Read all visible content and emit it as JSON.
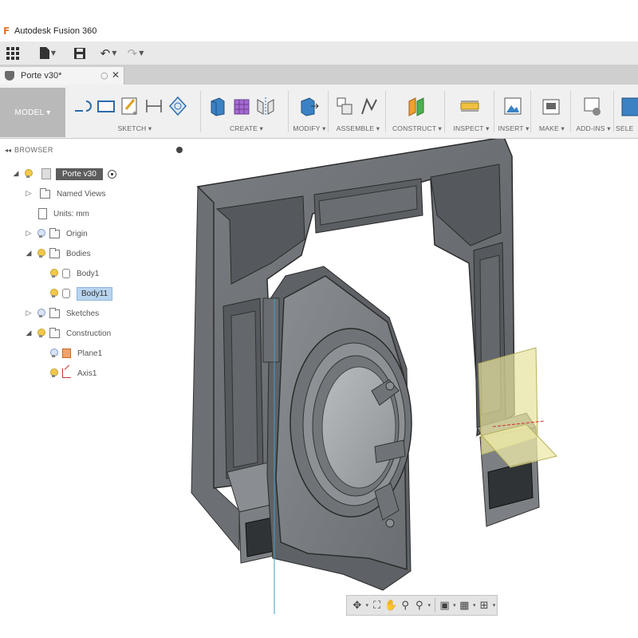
{
  "app": {
    "logo": "F",
    "title": "Autodesk Fusion 360"
  },
  "qat": {
    "grid_icon": "grid-icon",
    "file_icon": "file-icon",
    "save_icon": "save-icon",
    "undo_icon": "undo-icon",
    "redo_icon": "redo-icon"
  },
  "doc_tab": {
    "label": "Porte v30*",
    "status": "○",
    "close": "✕"
  },
  "ribbon": {
    "workspace": "MODEL ▾",
    "groups": [
      "SKETCH ▾",
      "CREATE ▾",
      "MODIFY ▾",
      "ASSEMBLE ▾",
      "CONSTRUCT ▾",
      "INSPECT ▾",
      "INSERT ▾",
      "MAKE ▾",
      "ADD-INS ▾",
      "SELE"
    ]
  },
  "browser": {
    "collapse": "◂◂",
    "title": "BROWSER",
    "root": "Porte v30",
    "items": [
      {
        "label": "Named Views"
      },
      {
        "label": "Units: mm"
      },
      {
        "label": "Origin"
      },
      {
        "label": "Bodies"
      },
      {
        "label": "Body1"
      },
      {
        "label": "Body11"
      },
      {
        "label": "Sketches"
      },
      {
        "label": "Construction"
      },
      {
        "label": "Plane1"
      },
      {
        "label": "Axis1"
      }
    ]
  },
  "navbar": [
    "orbit-icon",
    "look-at-icon",
    "pan-icon",
    "zoom-icon",
    "fit-icon",
    "display-settings-icon",
    "grid-settings-icon",
    "viewports-icon"
  ]
}
